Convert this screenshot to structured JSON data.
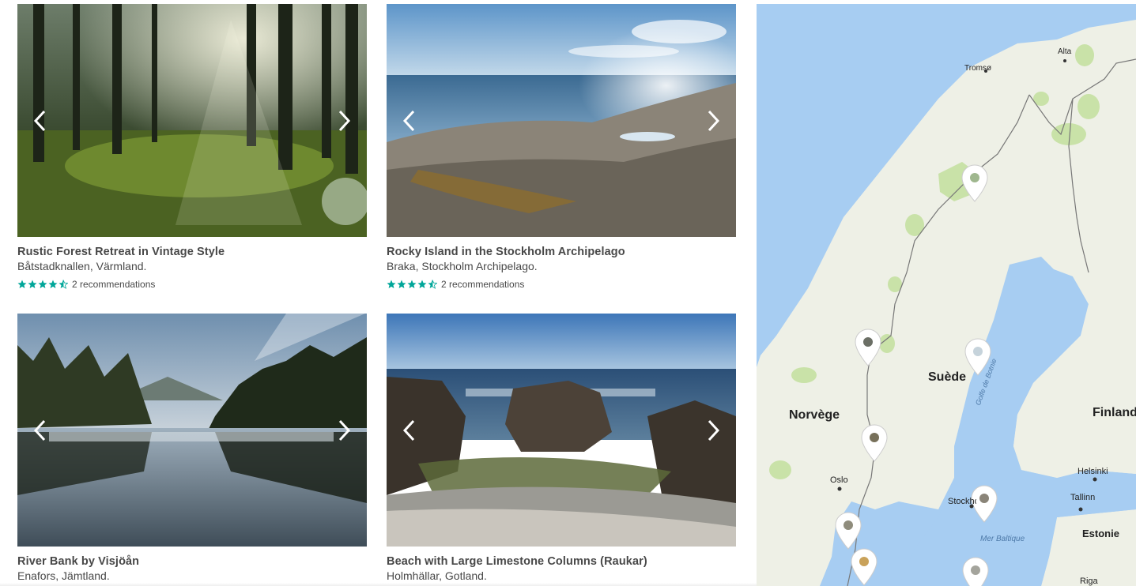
{
  "listings": [
    {
      "title": "Rustic Forest Retreat in Vintage Style",
      "location": "Båtstadknallen, Värmland.",
      "rating": 4.5,
      "recommendations": "2 recommendations",
      "image": "forest"
    },
    {
      "title": "Rocky Island in the Stockholm Archipelago",
      "location": "Braka, Stockholm Archipelago.",
      "rating": 4.5,
      "recommendations": "2 recommendations",
      "image": "archipelago"
    },
    {
      "title": "River Bank by Visjöån",
      "location": "Enafors, Jämtland.",
      "image": "river"
    },
    {
      "title": "Beach with Large Limestone Columns (Raukar)",
      "location": "Holmhällar, Gotland.",
      "image": "limestone"
    }
  ],
  "map": {
    "countries": [
      "Norvège",
      "Suède",
      "Finland"
    ],
    "cities": [
      "Alta",
      "Tromsø",
      "Oslo",
      "Stockholm",
      "Helsinki",
      "Tallinn",
      "Estonie",
      "Riga"
    ],
    "seas": [
      "Golfe de Botnie",
      "Mer Baltique"
    ],
    "marker_count": 7
  },
  "colors": {
    "accent": "#00a699",
    "text": "#484848",
    "water": "#a7cdf2",
    "land": "#eef0e6"
  }
}
